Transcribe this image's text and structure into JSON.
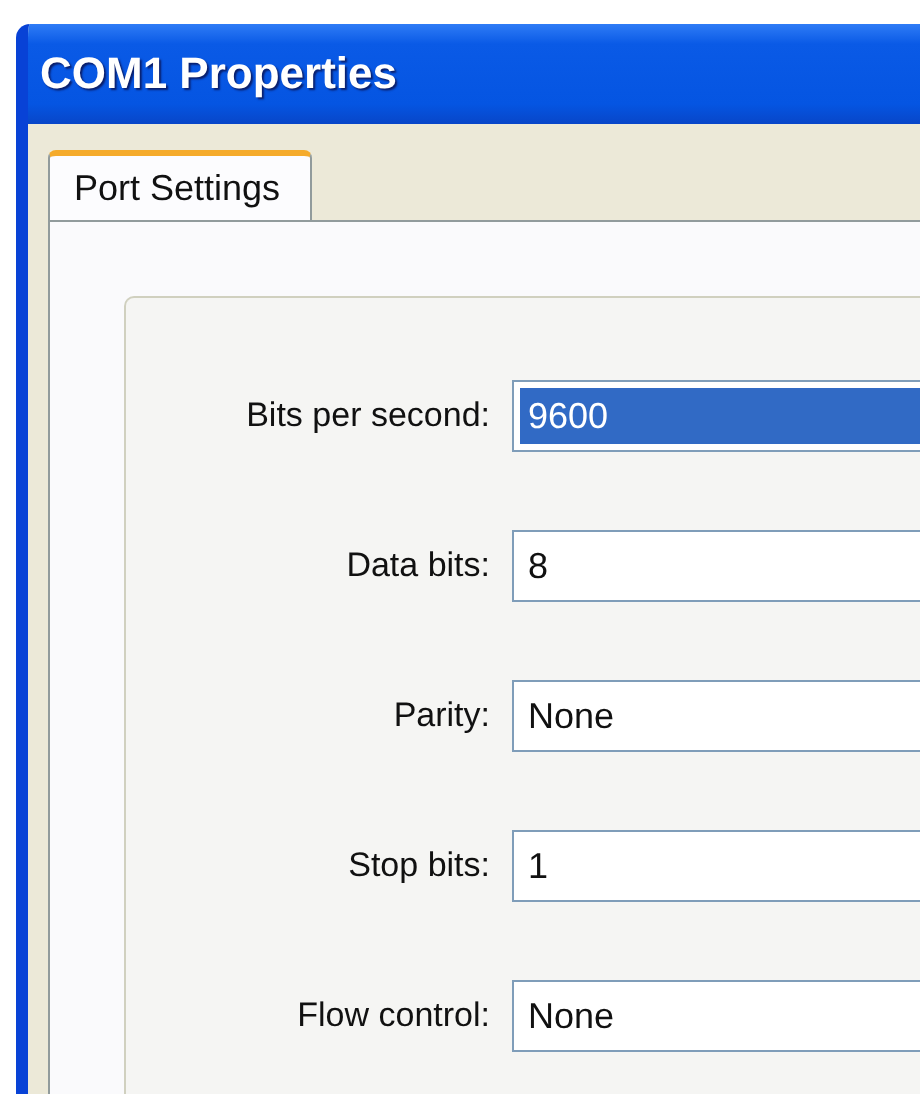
{
  "window": {
    "title": "COM1 Properties"
  },
  "tabs": [
    {
      "label": "Port Settings",
      "selected": true
    }
  ],
  "settings": [
    {
      "label": "Bits per second:",
      "value": "9600",
      "selected": true
    },
    {
      "label": "Data bits:",
      "value": "8",
      "selected": false
    },
    {
      "label": "Parity:",
      "value": "None",
      "selected": false
    },
    {
      "label": "Stop bits:",
      "value": "1",
      "selected": false
    },
    {
      "label": "Flow control:",
      "value": "None",
      "selected": false
    }
  ]
}
